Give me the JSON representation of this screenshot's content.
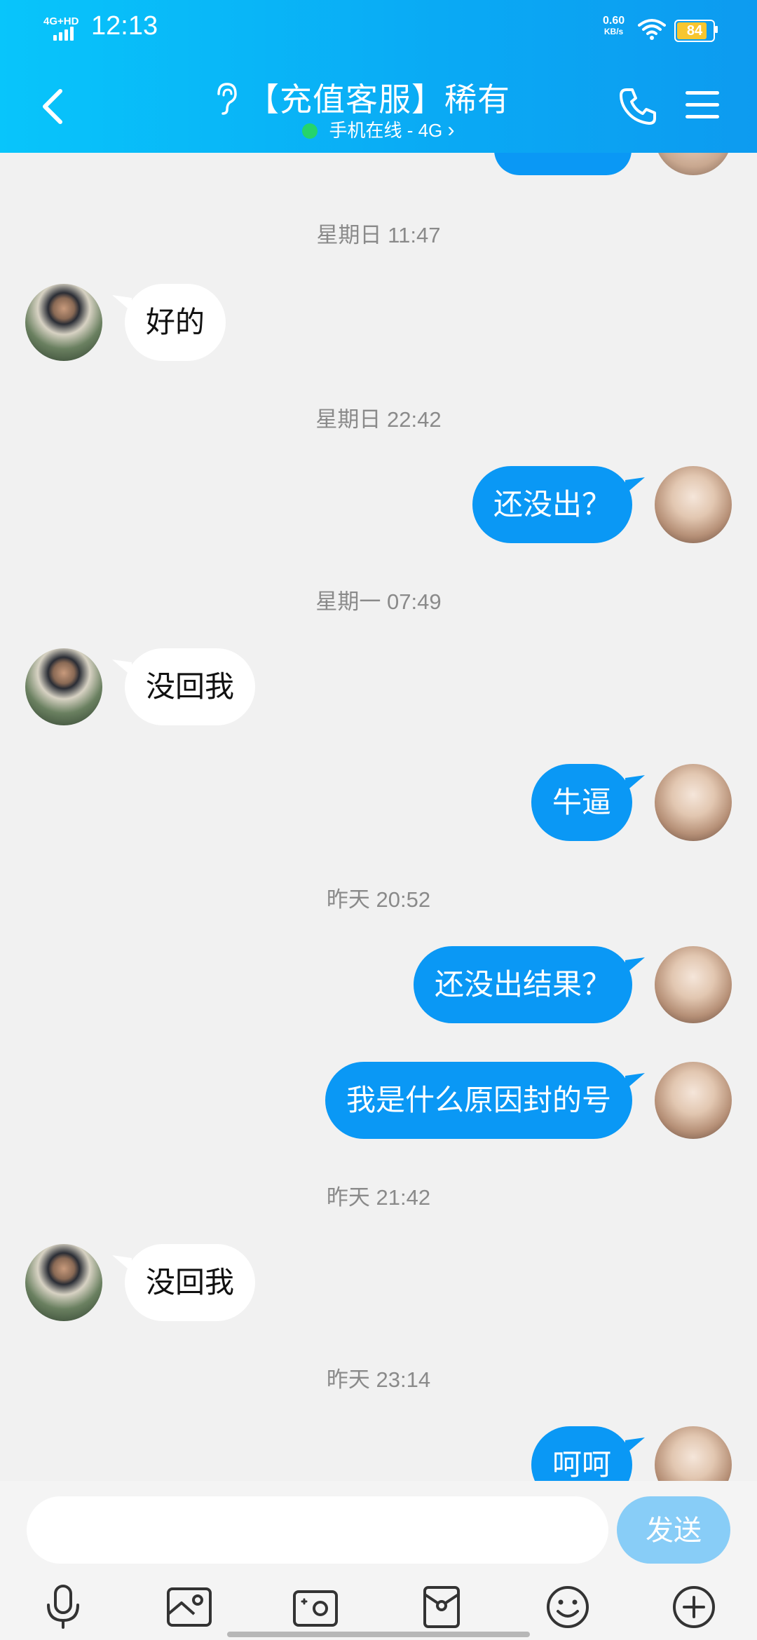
{
  "status_bar": {
    "network": "4G+HD",
    "time": "12:13",
    "speed_value": "0.60",
    "speed_unit": "KB/s",
    "battery_level": "84"
  },
  "header": {
    "title": "【充值客服】稀有",
    "subtitle": "手机在线 - 4G",
    "subtitle_chevron": "›"
  },
  "messages": [
    {
      "kind": "timestamp",
      "text": "星期日 11:47"
    },
    {
      "kind": "incoming",
      "text": "好的"
    },
    {
      "kind": "timestamp",
      "text": "星期日 22:42"
    },
    {
      "kind": "outgoing",
      "text": "还没出？"
    },
    {
      "kind": "timestamp",
      "text": "星期一 07:49"
    },
    {
      "kind": "incoming",
      "text": "没回我"
    },
    {
      "kind": "outgoing",
      "text": "牛逼"
    },
    {
      "kind": "timestamp",
      "text": "昨天 20:52"
    },
    {
      "kind": "outgoing",
      "text": "还没出结果？"
    },
    {
      "kind": "outgoing",
      "text": "我是什么原因封的号"
    },
    {
      "kind": "timestamp",
      "text": "昨天 21:42"
    },
    {
      "kind": "incoming",
      "text": "没回我"
    },
    {
      "kind": "timestamp",
      "text": "昨天 23:14"
    },
    {
      "kind": "outgoing",
      "text": "呵呵"
    }
  ],
  "input": {
    "value": "",
    "placeholder": "",
    "send_label": "发送"
  },
  "toolbar_icons": [
    "microphone-icon",
    "image-icon",
    "camera-icon",
    "red-packet-icon",
    "emoji-icon",
    "plus-icon"
  ],
  "colors": {
    "header_start": "#08c5fb",
    "header_end": "#0d9bf0",
    "bubble_out": "#0a98f5",
    "bubble_in": "#ffffff",
    "send_button": "#88cdf7",
    "online": "#25d46c",
    "battery": "#f7c62f"
  }
}
